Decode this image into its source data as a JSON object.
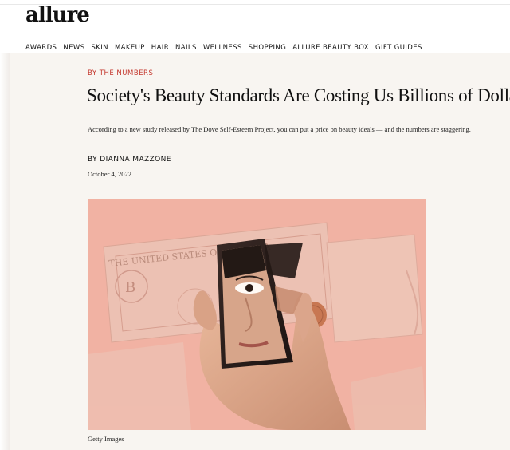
{
  "site": {
    "logo": "allure"
  },
  "nav": {
    "items": [
      "AWARDS",
      "NEWS",
      "SKIN",
      "MAKEUP",
      "HAIR",
      "NAILS",
      "WELLNESS",
      "SHOPPING",
      "ALLURE BEAUTY BOX",
      "GIFT GUIDES"
    ]
  },
  "article": {
    "rubric": "BY THE NUMBERS",
    "headline": "Society's Beauty Standards Are Costing Us Billions of Dollars",
    "dek": "According to a new study released by The Dove Self-Esteem Project, you can put a price on beauty ideals — and the numbers are staggering.",
    "byline_prefix": "BY ",
    "author": "DIANNA MAZZONE",
    "date": "October 4, 2022",
    "image": {
      "banknote_text": "THE UNITED STATES OF AMERICA",
      "caption": "Getty Images"
    }
  },
  "colors": {
    "accent": "#c4382e",
    "page_background": "#f8f5f1",
    "image_background": "#f1b2a3"
  }
}
